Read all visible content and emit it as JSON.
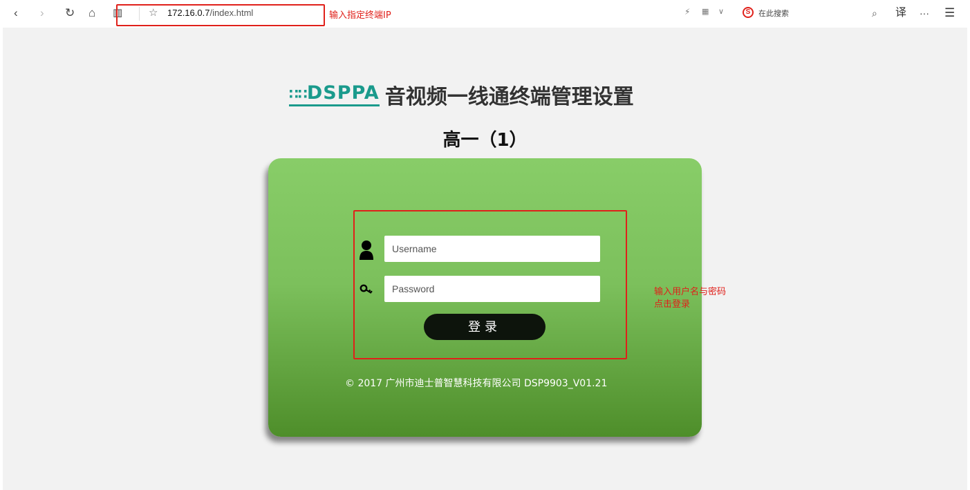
{
  "browser": {
    "url_host": "172.16.0.7",
    "url_path": "/index.html",
    "search_placeholder": "在此搜索",
    "translate_label": "译",
    "more_label": "···",
    "menu_label": "☰"
  },
  "annotations": {
    "url_hint": "输入指定终端IP",
    "login_hint_line1": "输入用户名与密码",
    "login_hint_line2": "点击登录"
  },
  "header": {
    "logo": "DSPPA",
    "title": "音视频一线通终端管理设置",
    "class_name": "高一（1）"
  },
  "login": {
    "username_placeholder": "Username",
    "password_placeholder": "Password",
    "username_value": "",
    "password_value": "",
    "submit_label": "登录"
  },
  "footer": {
    "text": "© 2017 广州市迪士普智慧科技有限公司 DSP9903_V01.21"
  }
}
